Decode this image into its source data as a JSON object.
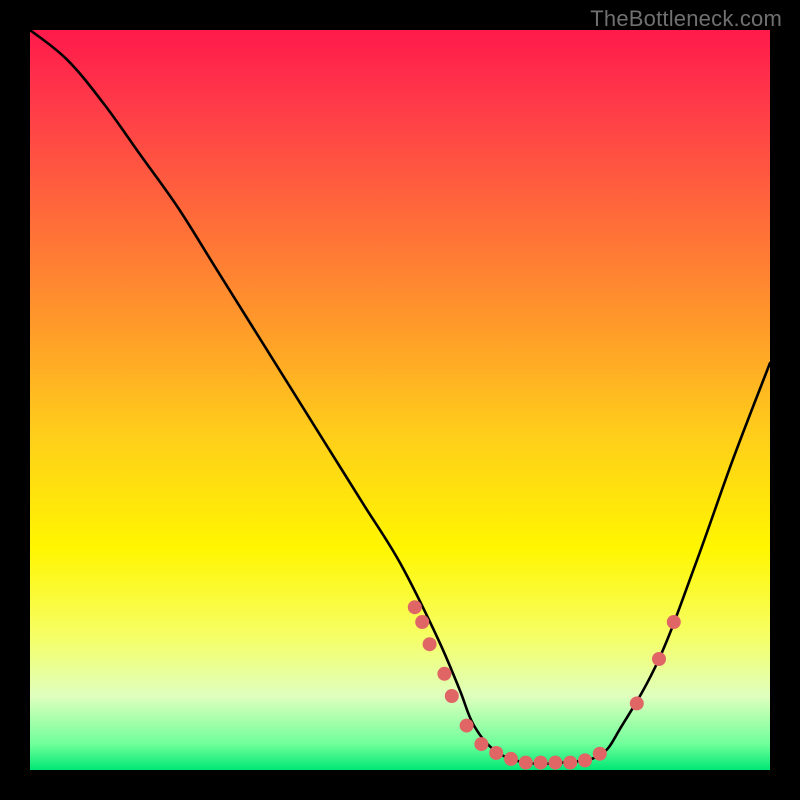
{
  "watermark": "TheBottleneck.com",
  "colors": {
    "gradient_stops": [
      {
        "offset": 0,
        "color": "#ff1a4b"
      },
      {
        "offset": 0.1,
        "color": "#ff3a49"
      },
      {
        "offset": 0.25,
        "color": "#ff6a3a"
      },
      {
        "offset": 0.4,
        "color": "#ff9a2a"
      },
      {
        "offset": 0.55,
        "color": "#ffcf1a"
      },
      {
        "offset": 0.7,
        "color": "#fff600"
      },
      {
        "offset": 0.82,
        "color": "#f6ff66"
      },
      {
        "offset": 0.9,
        "color": "#dfffbe"
      },
      {
        "offset": 0.965,
        "color": "#6fff9a"
      },
      {
        "offset": 1.0,
        "color": "#00e874"
      }
    ],
    "curve": "#000000",
    "dots": "#e06666",
    "watermark": "#707070"
  },
  "chart_data": {
    "type": "line",
    "title": "",
    "xlabel": "",
    "ylabel": "",
    "xlim": [
      0,
      100
    ],
    "ylim": [
      0,
      100
    ],
    "note": "x is normalized 0..100 across plot width; y is 0 (bottom) .. 100 (top). Curve descends from top-left to a flat valley near x≈60–77, then rises to the right edge.",
    "series": [
      {
        "name": "bottleneck-curve",
        "x": [
          0,
          5,
          10,
          15,
          20,
          25,
          30,
          35,
          40,
          45,
          50,
          55,
          58,
          60,
          63,
          67,
          72,
          77,
          80,
          85,
          90,
          95,
          100
        ],
        "values": [
          100,
          96,
          90,
          83,
          76,
          68,
          60,
          52,
          44,
          36,
          28,
          18,
          11,
          6,
          2.5,
          1,
          1,
          2,
          6,
          15,
          28,
          42,
          55
        ]
      }
    ],
    "annotations": {
      "name": "highlight-dots",
      "points": [
        {
          "x": 52,
          "y": 22
        },
        {
          "x": 53,
          "y": 20
        },
        {
          "x": 54,
          "y": 17
        },
        {
          "x": 56,
          "y": 13
        },
        {
          "x": 57,
          "y": 10
        },
        {
          "x": 59,
          "y": 6
        },
        {
          "x": 61,
          "y": 3.5
        },
        {
          "x": 63,
          "y": 2.3
        },
        {
          "x": 65,
          "y": 1.5
        },
        {
          "x": 67,
          "y": 1.0
        },
        {
          "x": 69,
          "y": 1.0
        },
        {
          "x": 71,
          "y": 1.0
        },
        {
          "x": 73,
          "y": 1.0
        },
        {
          "x": 75,
          "y": 1.3
        },
        {
          "x": 77,
          "y": 2.2
        },
        {
          "x": 82,
          "y": 9
        },
        {
          "x": 85,
          "y": 15
        },
        {
          "x": 87,
          "y": 20
        }
      ]
    }
  }
}
